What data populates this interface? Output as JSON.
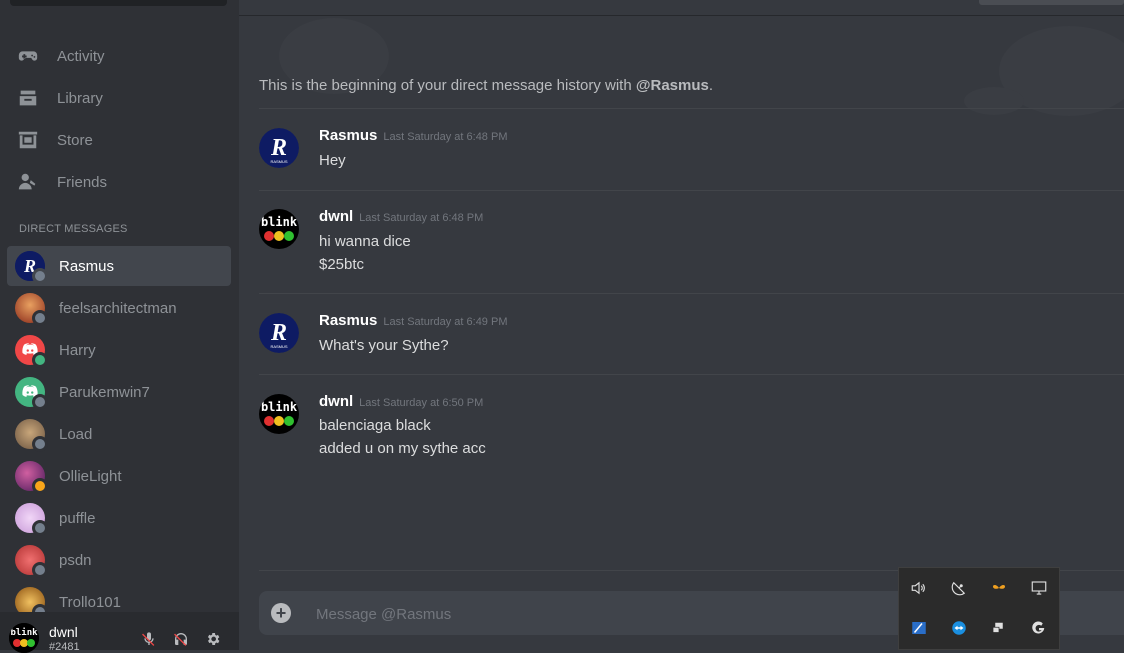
{
  "sidebar": {
    "nav": [
      {
        "label": "Activity",
        "icon": "gamepad-icon"
      },
      {
        "label": "Library",
        "icon": "library-icon"
      },
      {
        "label": "Store",
        "icon": "store-icon"
      },
      {
        "label": "Friends",
        "icon": "friends-icon"
      }
    ],
    "dm_header": "DIRECT MESSAGES",
    "dms": [
      {
        "name": "Rasmus",
        "status": "offline",
        "active": true
      },
      {
        "name": "feelsarchitectman",
        "status": "offline"
      },
      {
        "name": "Harry",
        "status": "online"
      },
      {
        "name": "Parukemwin7",
        "status": "offline"
      },
      {
        "name": "Load",
        "status": "offline"
      },
      {
        "name": "OllieLight",
        "status": "idle"
      },
      {
        "name": "puffle",
        "status": "offline"
      },
      {
        "name": "psdn",
        "status": "offline"
      },
      {
        "name": "Trollo101",
        "status": "offline"
      }
    ]
  },
  "user_panel": {
    "username": "dwnl",
    "tag": "#2481"
  },
  "chat": {
    "beginning_prefix": "This is the beginning of your direct message history with ",
    "beginning_user": "@Rasmus",
    "beginning_suffix": ".",
    "messages": [
      {
        "author": "Rasmus",
        "time": "Last Saturday at 6:48 PM",
        "lines": [
          "Hey"
        ]
      },
      {
        "author": "dwnl",
        "time": "Last Saturday at 6:48 PM",
        "lines": [
          "hi wanna dice",
          "$25btc"
        ]
      },
      {
        "author": "Rasmus",
        "time": "Last Saturday at 6:49 PM",
        "lines": [
          "What's your Sythe?"
        ]
      },
      {
        "author": "dwnl",
        "time": "Last Saturday at 6:50 PM",
        "lines": [
          "balenciaga black",
          "added u on my sythe acc"
        ]
      }
    ],
    "composer_placeholder": "Message @Rasmus"
  },
  "colors": {
    "online": "#43b581",
    "idle": "#faa61a",
    "offline": "#747f8d",
    "blurple": "#7289da"
  }
}
